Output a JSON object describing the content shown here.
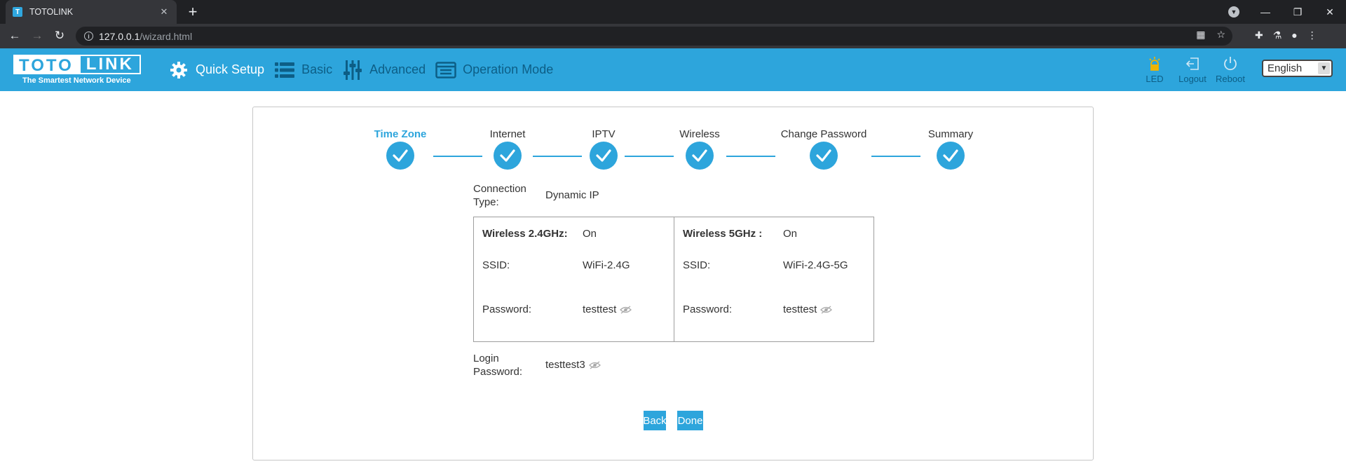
{
  "browser": {
    "tab_title": "TOTOLINK",
    "url_host": "127.0.0.1",
    "url_path": "/wizard.html"
  },
  "header": {
    "logo_text_left": "TOTO",
    "logo_text_right": "LINK",
    "logo_tagline": "The Smartest Network Device",
    "menu": [
      {
        "label": "Quick Setup",
        "icon": "gear-icon",
        "active": true
      },
      {
        "label": "Basic",
        "icon": "list-icon",
        "active": false
      },
      {
        "label": "Advanced",
        "icon": "sliders-icon",
        "active": false
      },
      {
        "label": "Operation Mode",
        "icon": "mode-icon",
        "active": false
      }
    ],
    "actions": [
      {
        "label": "LED",
        "icon": "led-icon"
      },
      {
        "label": "Logout",
        "icon": "logout-icon"
      },
      {
        "label": "Reboot",
        "icon": "power-icon"
      }
    ],
    "language": "English"
  },
  "wizard": {
    "steps": [
      {
        "label": "Time Zone",
        "active": true,
        "completed": true
      },
      {
        "label": "Internet",
        "active": false,
        "completed": true
      },
      {
        "label": "IPTV",
        "active": false,
        "completed": true
      },
      {
        "label": "Wireless",
        "active": false,
        "completed": true
      },
      {
        "label": "Change Password",
        "active": false,
        "completed": true
      },
      {
        "label": "Summary",
        "active": false,
        "completed": true
      }
    ],
    "connection_type_label_1": "Connection",
    "connection_type_label_2": "Type:",
    "connection_type_value": "Dynamic IP",
    "wifi_24": {
      "title": "Wireless 2.4GHz:",
      "status": "On",
      "ssid_label": "SSID:",
      "ssid": "WiFi-2.4G",
      "password_label": "Password:",
      "password": "testtest"
    },
    "wifi_5": {
      "title": "Wireless 5GHz :",
      "status": "On",
      "ssid_label": "SSID:",
      "ssid": "WiFi-2.4G-5G",
      "password_label": "Password:",
      "password": "testtest"
    },
    "login_password_label_1": "Login",
    "login_password_label_2": "Password:",
    "login_password": "testtest3",
    "back_label": "Back",
    "done_label": "Done"
  },
  "colors": {
    "accent": "#2da5dc",
    "menu_inactive": "#0d5e86"
  }
}
